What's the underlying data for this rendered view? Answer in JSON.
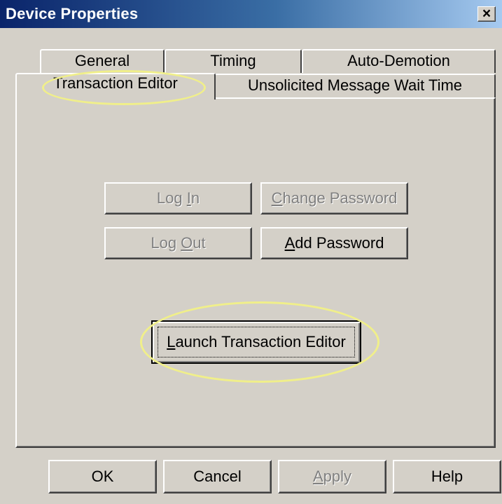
{
  "window": {
    "title": "Device Properties",
    "close_label": "×"
  },
  "tabs": {
    "row1": [
      {
        "label": "General"
      },
      {
        "label": "Timing"
      },
      {
        "label": "Auto-Demotion"
      }
    ],
    "row2": [
      {
        "label": "Transaction Editor",
        "selected": true
      },
      {
        "label": "Unsolicited Message Wait Time"
      }
    ]
  },
  "panel": {
    "login": {
      "prefix": "Log ",
      "accel": "I",
      "suffix": "n",
      "enabled": false
    },
    "change_password": {
      "prefix": "",
      "accel": "C",
      "suffix": "hange Password",
      "enabled": false
    },
    "logout": {
      "prefix": "Log ",
      "accel": "O",
      "suffix": "ut",
      "enabled": false
    },
    "add_password": {
      "prefix": "",
      "accel": "A",
      "suffix": "dd Password",
      "enabled": true
    },
    "launch": {
      "prefix": "",
      "accel": "L",
      "suffix": "aunch Transaction Editor",
      "enabled": true,
      "default": true
    }
  },
  "footer": {
    "ok": {
      "label": "OK",
      "enabled": true
    },
    "cancel": {
      "label": "Cancel",
      "enabled": true
    },
    "apply": {
      "prefix": "",
      "accel": "A",
      "suffix": "pply",
      "enabled": false
    },
    "help": {
      "label": "Help",
      "enabled": true
    }
  },
  "colors": {
    "face": "#d4d0c8",
    "title_start": "#0a246a",
    "title_end": "#a6caf0",
    "highlight": "#f0ef8a",
    "disabled_text": "#808080"
  }
}
